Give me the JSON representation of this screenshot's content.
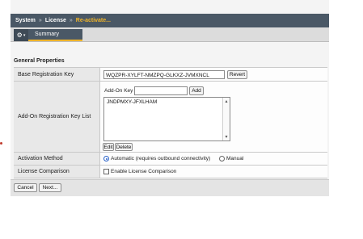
{
  "breadcrumb": {
    "items": [
      "System",
      "License"
    ],
    "separator": "»",
    "current": "Re-activate..."
  },
  "tabs": {
    "menu_icon": "gear-icon",
    "summary_label": "Summary"
  },
  "section": {
    "title": "General Properties"
  },
  "base_key": {
    "label": "Base Registration Key",
    "value": "WQZPR-XYLFT-NMZPQ-GLKXZ-JVMXNCL",
    "revert_label": "Revert"
  },
  "addon": {
    "label": "Add-On Registration Key List",
    "key_label": "Add-On Key",
    "key_value": "",
    "add_label": "Add",
    "items": [
      "JNDPMXY-JFXLHAM"
    ],
    "edit_label": "Edit",
    "delete_label": "Delete"
  },
  "activation": {
    "label": "Activation Method",
    "automatic_label": "Automatic (requires outbound connectivity)",
    "manual_label": "Manual",
    "selected": "automatic"
  },
  "comparison": {
    "label": "License Comparison",
    "checkbox_label": "Enable License Comparison",
    "checked": false
  },
  "footer": {
    "cancel_label": "Cancel",
    "next_label": "Next..."
  }
}
